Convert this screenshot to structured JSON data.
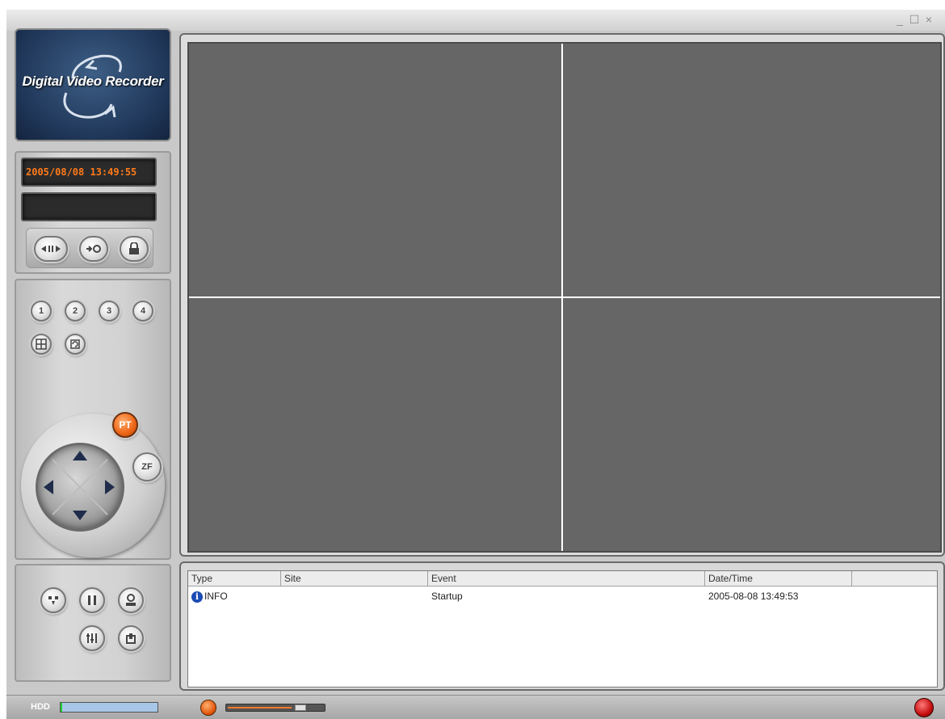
{
  "window": {
    "controls": [
      "minimize",
      "maximize",
      "close"
    ],
    "control_glyphs": {
      "minimize": "_",
      "maximize": "☐",
      "close": "×"
    }
  },
  "logo": {
    "text": "Digital Video Recorder"
  },
  "display": {
    "datetime": "2005/08/08 13:49:55",
    "secondary": ""
  },
  "controls": {
    "top_buttons": [
      "record-icon",
      "setup-icon",
      "lock-icon"
    ],
    "camera_buttons": [
      "1",
      "2",
      "3",
      "4"
    ],
    "view_buttons": [
      "quad-view-icon",
      "sequence-icon"
    ],
    "ptz": {
      "pt_label": "PT",
      "zf_label": "ZF"
    },
    "playback_buttons": [
      "search-icon",
      "pause-icon",
      "user-icon",
      "settings-icon",
      "backup-icon"
    ]
  },
  "video": {
    "cells": 4
  },
  "log": {
    "columns": [
      "Type",
      "Site",
      "Event",
      "Date/Time"
    ],
    "rows": [
      {
        "type": "INFO",
        "site": "",
        "event": "Startup",
        "datetime": "2005-08-08 13:49:53"
      }
    ]
  },
  "status": {
    "hdd_label": "HDD",
    "hdd_used_fraction": 0.02,
    "volume_fraction": 0.8
  },
  "colors": {
    "video_background": "#666666",
    "lcd_text": "#ff7a1a",
    "accent_orange": "#f06a1c",
    "info_blue": "#1a4bb5"
  }
}
